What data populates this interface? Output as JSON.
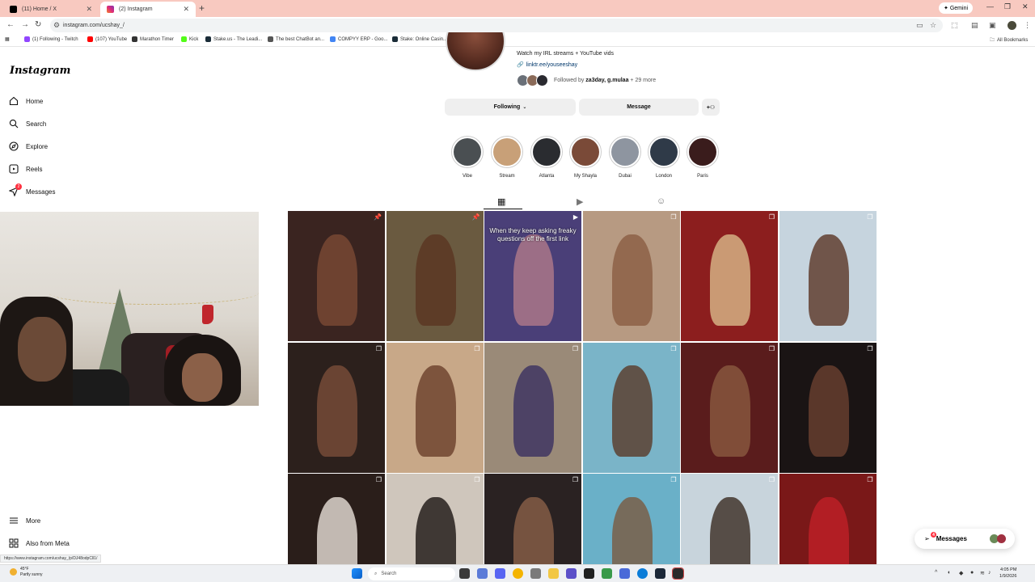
{
  "browser": {
    "tabs": [
      {
        "title": "(11) Home / X",
        "favicon_color": "#000000"
      },
      {
        "title": "(2) Instagram",
        "favicon_color": "#e1306c"
      }
    ],
    "gemini_label": "Gemini",
    "url": "instagram.com/ucshay_/",
    "bookmarks": [
      {
        "label": "(1) Following - Twitch",
        "color": "#9146ff"
      },
      {
        "label": "(107) YouTube",
        "color": "#ff0000"
      },
      {
        "label": "Marathon Timer",
        "color": "#333333"
      },
      {
        "label": "Kick",
        "color": "#53fc18"
      },
      {
        "label": "Stake.us - The Leadi...",
        "color": "#1a2c38"
      },
      {
        "label": "The best ChatBot an...",
        "color": "#555555"
      },
      {
        "label": "COMPYY ERP - Goo...",
        "color": "#4285f4"
      },
      {
        "label": "Stake: Online Casin...",
        "color": "#1a2c38"
      }
    ],
    "all_bookmarks": "All Bookmarks"
  },
  "sidebar": {
    "logo": "Instagram",
    "items": [
      {
        "label": "Home",
        "icon": "home-icon"
      },
      {
        "label": "Search",
        "icon": "search-icon"
      },
      {
        "label": "Explore",
        "icon": "compass-icon"
      },
      {
        "label": "Reels",
        "icon": "reels-icon"
      },
      {
        "label": "Messages",
        "icon": "messages-icon",
        "badge": "2"
      }
    ],
    "bottom": [
      {
        "label": "More",
        "icon": "menu-icon"
      },
      {
        "label": "Also from Meta",
        "icon": "meta-icon"
      }
    ]
  },
  "profile": {
    "bio": "Watch my IRL streams + YouTube vids",
    "link": "linktr.ee/youseeshay",
    "followed_prefix": "Followed by ",
    "followed_names": "za3day, g.mulaa",
    "followed_more": " + 29 more",
    "following_label": "Following",
    "message_label": "Message",
    "highlights": [
      {
        "label": "Vibe",
        "color": "#4a4f52"
      },
      {
        "label": "Stream",
        "color": "#c8a078"
      },
      {
        "label": "Atlanta",
        "color": "#2a2c30"
      },
      {
        "label": "My Shayla",
        "color": "#7a4a38"
      },
      {
        "label": "Dubai",
        "color": "#8e95a0"
      },
      {
        "label": "London",
        "color": "#2f3a48"
      },
      {
        "label": "Paris",
        "color": "#3a1c1c"
      }
    ]
  },
  "grid": {
    "posts": [
      {
        "bg": "#3a2420",
        "fig": "#7c4a35",
        "mark": "pin"
      },
      {
        "bg": "#6a5a40",
        "fig": "#5a3420",
        "mark": "pin"
      },
      {
        "bg": "#4a3f78",
        "fig": "#b07a8a",
        "mark": "reel",
        "text": "When they keep asking freaky questions off the first link"
      },
      {
        "bg": "#b79a82",
        "fig": "#8a5c42",
        "mark": "multi"
      },
      {
        "bg": "#8c1e1e",
        "fig": "#d9b98a",
        "mark": "multi"
      },
      {
        "bg": "#c6d4de",
        "fig": "#5a3424",
        "mark": "multi"
      },
      {
        "bg": "#2c201c",
        "fig": "#7a4e3a",
        "mark": "multi"
      },
      {
        "bg": "#c8a888",
        "fig": "#6a3e2a",
        "mark": "multi"
      },
      {
        "bg": "#9a8a78",
        "fig": "#3a3060",
        "mark": "multi"
      },
      {
        "bg": "#7ab4c8",
        "fig": "#5a3a28",
        "mark": "multi"
      },
      {
        "bg": "#5a1c1c",
        "fig": "#8a5a40",
        "mark": "multi"
      },
      {
        "bg": "#1a1414",
        "fig": "#6a4030",
        "mark": "multi"
      },
      {
        "bg": "#2a1e1a",
        "fig": "#e8e0d8",
        "mark": "multi"
      },
      {
        "bg": "#cfc6bc",
        "fig": "#1a1412",
        "mark": "multi"
      },
      {
        "bg": "#2a2222",
        "fig": "#8a6048",
        "mark": "multi"
      },
      {
        "bg": "#6ab0c8",
        "fig": "#7a5a40",
        "mark": "multi"
      },
      {
        "bg": "#c8d4dc",
        "fig": "#3a2a22",
        "mark": "multi"
      },
      {
        "bg": "#7a1818",
        "fig": "#c02028",
        "mark": "multi"
      }
    ]
  },
  "messages_pill": {
    "label": "Messages",
    "badge": "4"
  },
  "status_url": "https://www.instagram.com/ucshay_/p/DJ48odpCll1/",
  "taskbar": {
    "weather_temp": "45°F",
    "weather_desc": "Partly sunny",
    "weather_badge": "1",
    "search_placeholder": "Search",
    "time": "4:05 PM",
    "date": "1/9/2026"
  }
}
